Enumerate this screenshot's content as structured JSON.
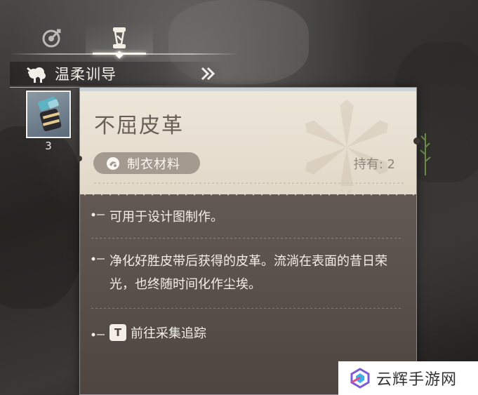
{
  "tabs": [
    {
      "icon": "quest-target-icon",
      "selected": false
    },
    {
      "icon": "scroll-item-icon",
      "selected": true
    }
  ],
  "category": {
    "label": "温柔训导",
    "icon": "sheep-icon",
    "next_icon": "double-chevron-right-icon"
  },
  "slot": {
    "icon": "leather-item-icon",
    "count": "3"
  },
  "item": {
    "name": "不屈皮革",
    "type_label": "制衣材料",
    "type_icon": "material-icon",
    "owned": "持有: 2",
    "description_1": "可用于设计图制作。",
    "description_2": "净化好胜皮带后获得的皮革。流淌在表面的昔日荣光，也终随时间化作尘埃。",
    "track_key": "T",
    "track_label": "前往采集追踪"
  },
  "watermark": {
    "text": "云辉手游网",
    "logo": "watermark-logo-icon"
  },
  "colors": {
    "panel_head": "#ede6da",
    "panel_body": "#5e5450",
    "pill": "#a59a90",
    "title_text": "#6a5f58"
  }
}
